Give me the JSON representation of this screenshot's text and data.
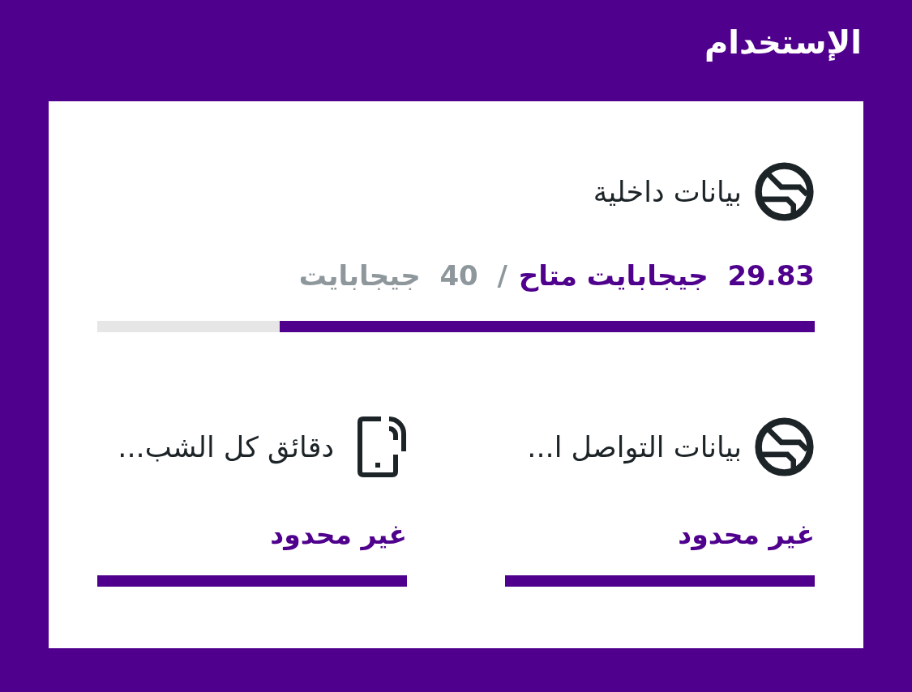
{
  "page": {
    "title": "الإستخدام"
  },
  "main_balance": {
    "kind": "data",
    "title": "بيانات داخلية",
    "available": "29.83  جيجابايت متاح",
    "total": "/  40  جيجابايت",
    "level": 0.746
  },
  "allowances": [
    {
      "kind": "data",
      "title": "بيانات التواصل ا...",
      "value": "غير محدود",
      "level": 1
    },
    {
      "kind": "calls",
      "title": "دقائق كل الشب...",
      "value": "غير محدود",
      "level": 1
    }
  ]
}
